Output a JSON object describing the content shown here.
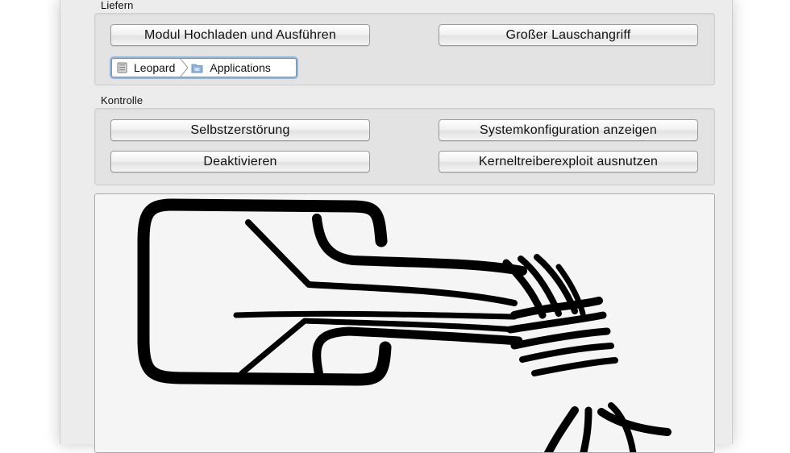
{
  "deliver": {
    "label": "Liefern",
    "upload_button": "Modul Hochladen und Ausführen",
    "eavesdrop_button": "Großer Lauschangriff",
    "path": [
      {
        "label": "Leopard",
        "icon": "disk-icon"
      },
      {
        "label": "Applications",
        "icon": "folder-icon"
      }
    ]
  },
  "control": {
    "label": "Kontrolle",
    "self_destruct_button": "Selbstzerstörung",
    "show_config_button": "Systemkonfiguration anzeigen",
    "deactivate_button": "Deaktivieren",
    "exploit_button": "Kerneltreiberexploit ausnutzen"
  },
  "logo": {
    "icon": "bundestrojaner-logo",
    "color": "#000000"
  },
  "colors": {
    "window_bg": "#ececec",
    "group_bg": "#e3e3e3",
    "focus_ring": "#8bb6e6"
  }
}
